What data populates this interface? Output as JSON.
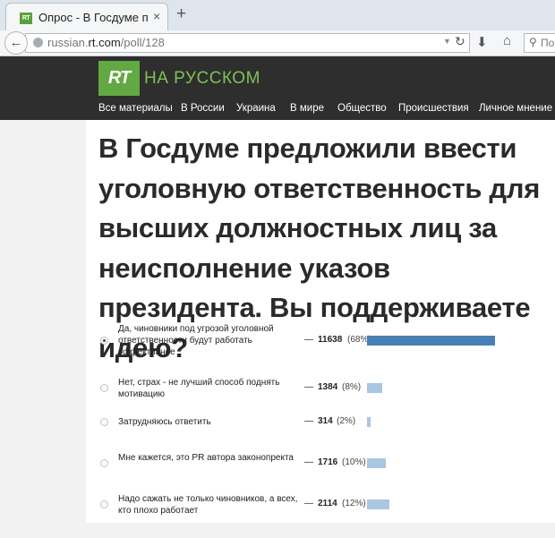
{
  "browser": {
    "tab_favicon": "RT",
    "tab_title": "Опрос - В Госдуме п...",
    "tab_close": "×",
    "new_tab": "+",
    "back_icon": "←",
    "url_prefix": "russian.",
    "url_domain": "rt.com",
    "url_path": "/poll/128",
    "reload_icon": "↻",
    "dropmark_icon": "▼",
    "download_icon": "⬇",
    "home_icon": "⌂",
    "search_icon": "⚲",
    "search_placeholder": "По"
  },
  "site": {
    "logo": "RT",
    "brand": "НА РУССКОМ",
    "nav": [
      "Все материалы",
      "В России",
      "Украина",
      "В мире",
      "Общество",
      "Происшествия",
      "Личное мнение"
    ]
  },
  "poll": {
    "question": "В Госдуме предложили ввести уголовную ответственность для высших должностных лиц за неисполнение указов президента. Вы поддерживаете идею?",
    "dash": "—",
    "options": [
      {
        "label": "Да, чиновники под угрозой уголовной ответственности будут работать эффективнее",
        "count": "11638",
        "pct": "(68%)",
        "share": 68,
        "selected": true
      },
      {
        "label": "Нет, страх - не лучший способ поднять мотивацию",
        "count": "1384",
        "pct": "(8%)",
        "share": 8,
        "selected": false
      },
      {
        "label": "Затрудняюсь ответить",
        "count": "314",
        "pct": "(2%)",
        "share": 2,
        "selected": false
      },
      {
        "label": "Мне кажется, это PR автора законопректа",
        "count": "1716",
        "pct": "(10%)",
        "share": 10,
        "selected": false
      },
      {
        "label": "Надо сажать не только чиновников, а всех, кто плохо работает",
        "count": "2114",
        "pct": "(12%)",
        "share": 12,
        "selected": false
      }
    ]
  },
  "colors": {
    "accent_green": "#62a843",
    "brand_text": "#7fc154",
    "bar_selected": "#4a7fb5",
    "bar_other": "#a9c6e2",
    "header_bg": "#2e2e2e"
  }
}
